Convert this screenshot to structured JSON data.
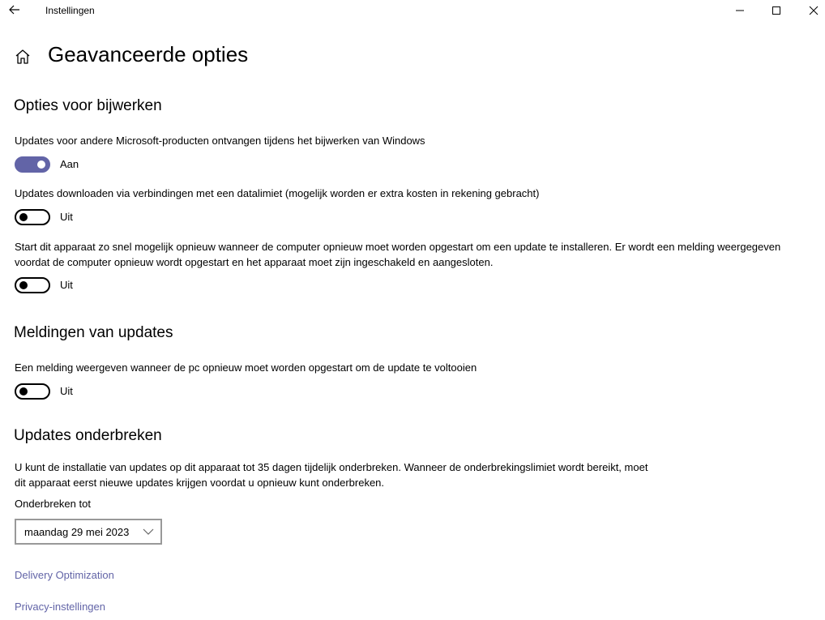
{
  "window": {
    "title": "Instellingen"
  },
  "page": {
    "title": "Geavanceerde opties"
  },
  "sections": {
    "update_options": {
      "heading": "Opties voor bijwerken",
      "items": [
        {
          "description": "Updates voor andere Microsoft-producten ontvangen tijdens het bijwerken van Windows",
          "state": "Aan",
          "on": true
        },
        {
          "description": "Updates downloaden via verbindingen met een datalimiet (mogelijk worden er extra kosten in rekening gebracht)",
          "state": "Uit",
          "on": false
        },
        {
          "description": "Start dit apparaat zo snel mogelijk opnieuw wanneer de computer opnieuw moet worden opgestart om een update te installeren. Er wordt een melding weergegeven voordat de computer opnieuw wordt opgestart en het apparaat moet zijn ingeschakeld en aangesloten.",
          "state": "Uit",
          "on": false
        }
      ]
    },
    "notifications": {
      "heading": "Meldingen van updates",
      "items": [
        {
          "description": "Een melding weergeven wanneer de pc opnieuw moet worden opgestart om de update te voltooien",
          "state": "Uit",
          "on": false
        }
      ]
    },
    "pause": {
      "heading": "Updates onderbreken",
      "description": "U kunt de installatie van updates op dit apparaat tot 35 dagen tijdelijk onderbreken. Wanneer de onderbrekingslimiet wordt bereikt, moet dit apparaat eerst nieuwe updates krijgen voordat u opnieuw kunt onderbreken.",
      "select_label": "Onderbreken tot",
      "select_value": "maandag 29 mei 2023"
    }
  },
  "links": {
    "delivery_optimization": "Delivery Optimization",
    "privacy": "Privacy-instellingen"
  },
  "colors": {
    "accent": "#6264a7"
  }
}
